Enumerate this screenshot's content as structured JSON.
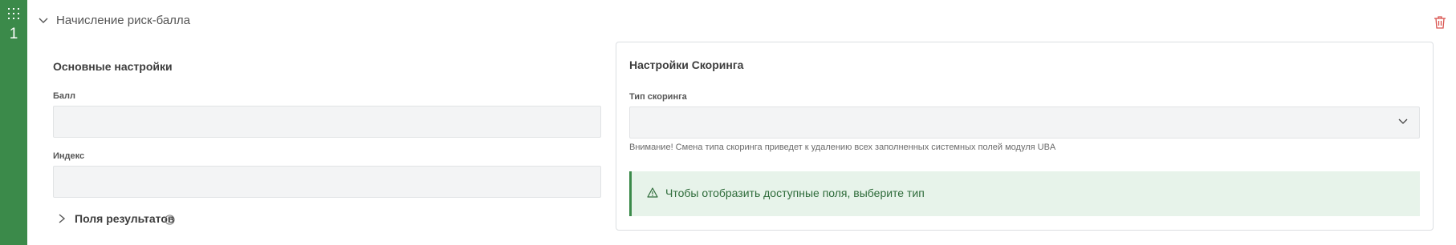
{
  "rail": {
    "index": "1",
    "drag_icon": "grid-drag-icon"
  },
  "section": {
    "title": "Начисление риск-балла",
    "toggle_icon": "chevron-down-icon",
    "delete_icon": "trash-icon"
  },
  "basic_settings": {
    "title": "Основные настройки",
    "score_label": "Балл",
    "score_value": "",
    "index_label": "Индекс",
    "index_value": ""
  },
  "result_fields": {
    "label": "Поля результатов",
    "toggle_icon": "chevron-right-icon",
    "help_icon": "question-circle-icon"
  },
  "scoring_settings": {
    "title": "Настройки Скоринга",
    "type_label": "Тип скоринга",
    "type_value": "",
    "hint": "Внимание! Смена типа скоринга приведет к удалению всех заполненных системных полей модуля UBA",
    "alert_text": "Чтобы отобразить доступные поля, выберите тип",
    "alert_icon": "warning-triangle-icon"
  },
  "colors": {
    "accent": "#3b8a4a",
    "delete": "#d9534f",
    "alert_bg": "#e7f3ea",
    "alert_text": "#2e6b3a",
    "field_bg": "#f3f4f5"
  }
}
